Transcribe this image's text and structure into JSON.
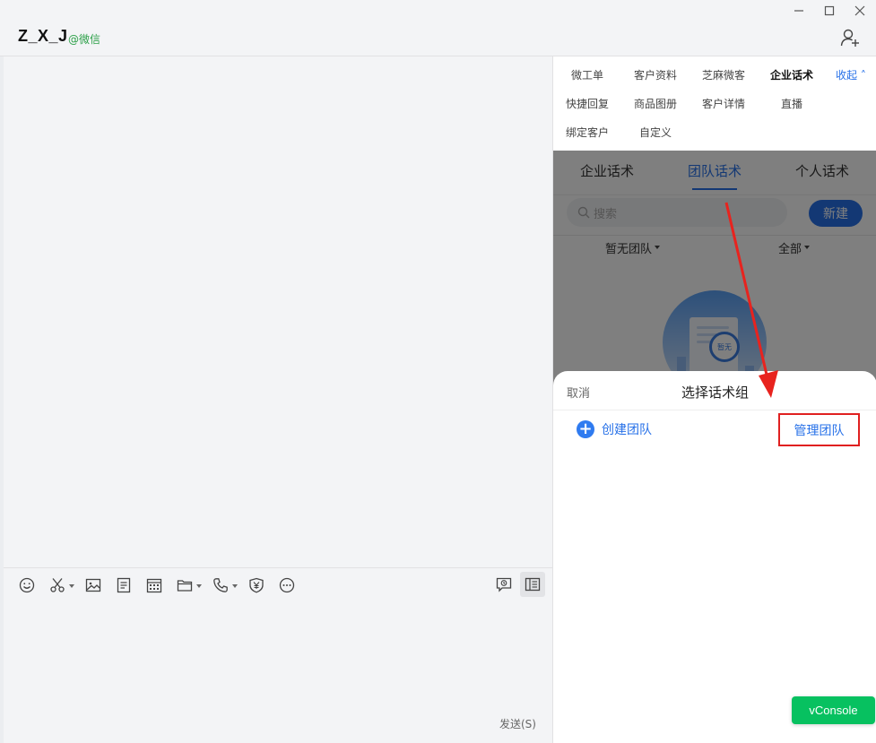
{
  "header": {
    "chat_name": "Z_X_J",
    "chat_tag": "@微信"
  },
  "toolbar": {
    "send_label": "发送(S)"
  },
  "panel_tabs": {
    "row1": [
      "微工单",
      "客户资料",
      "芝麻微客",
      "企业话术"
    ],
    "row2": [
      "快捷回复",
      "商品图册",
      "客户详情",
      "直播"
    ],
    "row3": [
      "绑定客户",
      "自定义"
    ],
    "collapse": "收起",
    "active": "企业话术"
  },
  "embedded": {
    "tabs": [
      "企业话术",
      "团队话术",
      "个人话术"
    ],
    "active_tab": "团队话术",
    "search_placeholder": "搜索",
    "new_button": "新建",
    "filter_team": "暂无团队",
    "filter_all": "全部",
    "empty_badge": "暂无"
  },
  "sheet": {
    "cancel": "取消",
    "title": "选择话术组",
    "create_team": "创建团队",
    "manage_team": "管理团队"
  },
  "vconsole": "vConsole",
  "colors": {
    "accent": "#2670e8",
    "wechat_green": "#07c160",
    "highlight_red": "#e02020"
  }
}
